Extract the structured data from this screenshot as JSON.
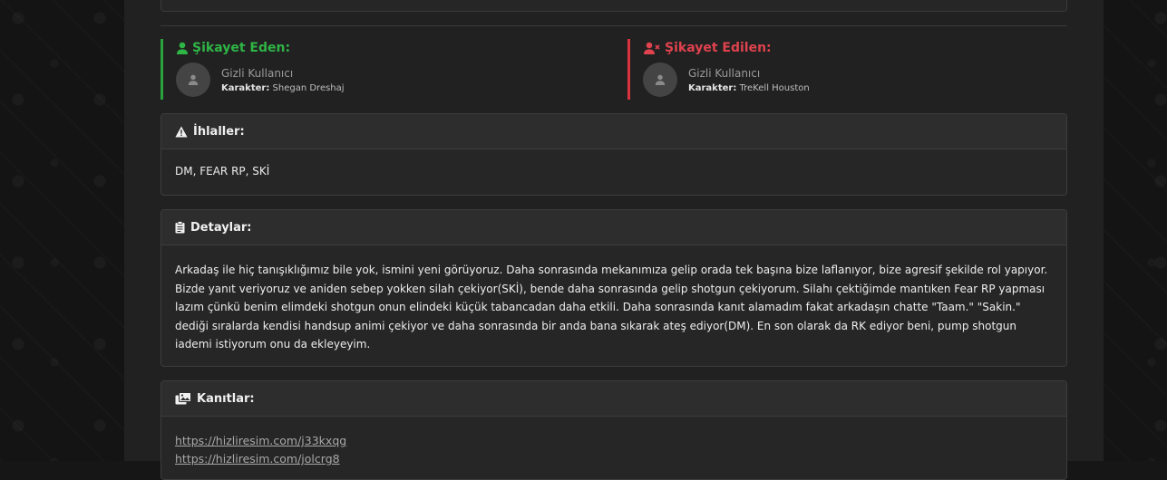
{
  "complainant": {
    "title": "Şikayet Eden:",
    "user_name": "Gizli Kullanıcı",
    "character_label": "Karakter:",
    "character_name": "Shegan Dreshaj",
    "color": "#2fb546"
  },
  "reported": {
    "title": "Şikayet Edilen:",
    "user_name": "Gizli Kullanıcı",
    "character_label": "Karakter:",
    "character_name": "TreKell Houston",
    "color": "#e0424e"
  },
  "violations": {
    "title": "İhlaller:",
    "text": "DM, FEAR RP, SKİ",
    "icon": "warning-icon"
  },
  "details": {
    "title": "Detaylar:",
    "text": "Arkadaş ile hiç tanışıklığımız bile yok, ismini yeni görüyoruz. Daha sonrasında mekanımıza gelip orada tek başına bize laflanıyor, bize agresif şekilde rol yapıyor. Bizde yanıt veriyoruz ve aniden sebep yokken silah çekiyor(SKİ), bende daha sonrasında gelip shotgun çekiyorum. Silahı çektiğimde mantıken Fear RP yapması lazım çünkü benim elimdeki shotgun onun elindeki küçük tabancadan daha etkili. Daha sonrasında kanıt alamadım fakat arkadaşın chatte \"Taam.\" \"Sakin.\" dediği sıralarda kendisi handsup animi çekiyor ve daha sonrasında bir anda bana sıkarak ateş ediyor(DM).  En son olarak da RK ediyor beni, pump shotgun iademi istiyorum onu da ekleyeyim.",
    "icon": "clipboard-icon"
  },
  "evidence": {
    "title": "Kanıtlar:",
    "icon": "images-icon",
    "links": [
      "https://hizliresim.com/j33kxqg",
      "https://hizliresim.com/jolcrg8"
    ]
  }
}
